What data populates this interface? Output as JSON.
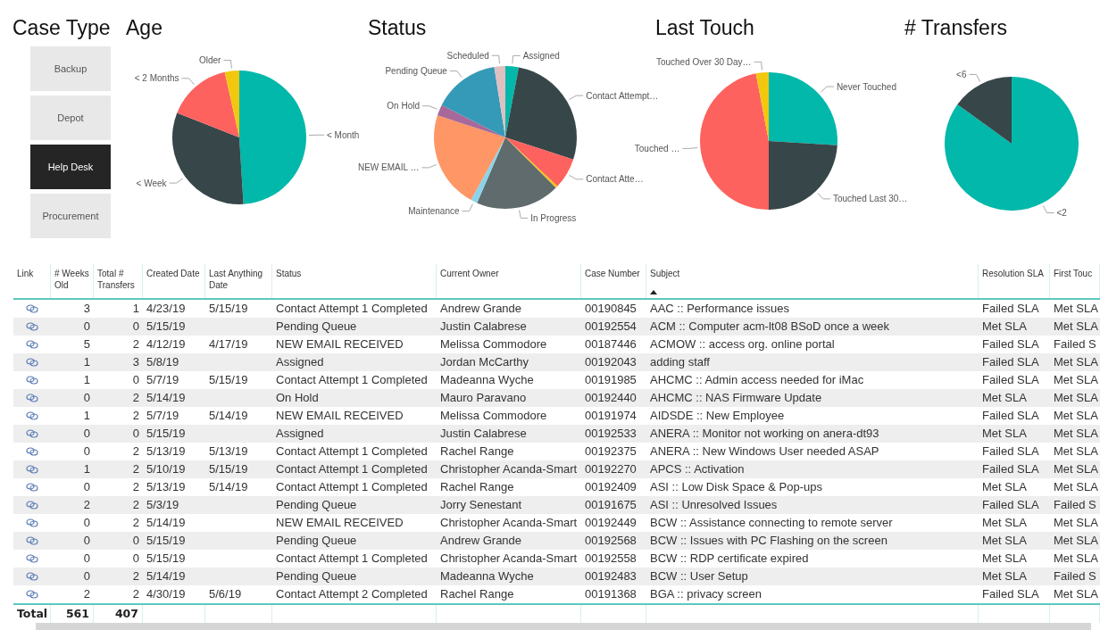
{
  "case_type": {
    "title": "Case Type",
    "buttons": [
      {
        "label": "Backup",
        "selected": false
      },
      {
        "label": "Depot",
        "selected": false
      },
      {
        "label": "Help Desk",
        "selected": true
      },
      {
        "label": "Procurement",
        "selected": false
      }
    ]
  },
  "charts": [
    {
      "title": "Age",
      "slices": [
        {
          "label": "< Month",
          "color": "#01b8aa"
        },
        {
          "label": "< Week",
          "color": "#374649"
        },
        {
          "label": "< 2 Months",
          "color": "#fd625e"
        },
        {
          "label": "Older",
          "color": "#f2c80f"
        }
      ]
    },
    {
      "title": "Status",
      "slices": [
        {
          "label": "Scheduled",
          "color": "#dfbfbf"
        },
        {
          "label": "Assigned",
          "color": "#01b8aa"
        },
        {
          "label": "Pending Queue",
          "color": "#3599b8"
        },
        {
          "label": "Contact Attempt…",
          "color": "#374649"
        },
        {
          "label": "On Hold",
          "color": "#a66999"
        },
        {
          "label": "Contact Atte…",
          "color": "#fd625e"
        },
        {
          "label": "NEW EMAIL …",
          "color": "#fe9666"
        },
        {
          "label": "Maintenance",
          "color": "#8ad4eb"
        },
        {
          "label": "In Progress",
          "color": "#5f6b6d"
        },
        {
          "color": "#f2c80f"
        }
      ]
    },
    {
      "title": "Last Touch",
      "slices": [
        {
          "label": "Never Touched",
          "color": "#01b8aa"
        },
        {
          "label": "Touched Last 30…",
          "color": "#374649"
        },
        {
          "label": "Touched …",
          "color": "#fd625e"
        },
        {
          "label": "Touched Over 30 Day…",
          "color": "#f2c80f"
        }
      ]
    },
    {
      "title": "# Transfers",
      "slices": [
        {
          "label": "<2",
          "color": "#01b8aa"
        },
        {
          "label": "<6",
          "color": "#374649"
        }
      ]
    }
  ],
  "table": {
    "columns": [
      {
        "label": "Link",
        "sorted": false
      },
      {
        "label": "# Weeks Old",
        "sorted": false
      },
      {
        "label": "Total # Transfers",
        "sorted": false
      },
      {
        "label": "Created Date",
        "sorted": false
      },
      {
        "label": "Last Anything Date",
        "sorted": false
      },
      {
        "label": "Status",
        "sorted": false
      },
      {
        "label": "Current Owner",
        "sorted": false
      },
      {
        "label": "Case Number",
        "sorted": false
      },
      {
        "label": "Subject",
        "sorted": true
      },
      {
        "label": "Resolution SLA",
        "sorted": false
      },
      {
        "label": "First Touc",
        "sorted": false
      }
    ],
    "rows": [
      {
        "weeks": "3",
        "transfers": "1",
        "created": "4/23/19",
        "last": "5/15/19",
        "status": "Contact Attempt 1 Completed",
        "owner": "Andrew Grande",
        "case": "00190845",
        "subject": "AAC :: Performance issues",
        "resolution": "Failed SLA",
        "first_touch": "Met SLA"
      },
      {
        "weeks": "0",
        "transfers": "0",
        "created": "5/15/19",
        "status": "Pending Queue",
        "owner": "Justin Calabrese",
        "case": "00192554",
        "subject": "ACM :: Computer acm-lt08 BSoD once a week",
        "resolution": "Met SLA",
        "first_touch": "Met SLA"
      },
      {
        "weeks": "5",
        "transfers": "2",
        "created": "4/12/19",
        "last": "4/17/19",
        "status": "NEW EMAIL RECEIVED",
        "owner": "Melissa Commodore",
        "case": "00187446",
        "subject": "ACMOW :: access org. online portal",
        "resolution": "Failed SLA",
        "first_touch": "Failed S"
      },
      {
        "weeks": "1",
        "transfers": "3",
        "created": "5/8/19",
        "status": "Assigned",
        "owner": "Jordan McCarthy",
        "case": "00192043",
        "subject": "adding staff",
        "resolution": "Failed SLA",
        "first_touch": "Met SLA"
      },
      {
        "weeks": "1",
        "transfers": "0",
        "created": "5/7/19",
        "last": "5/15/19",
        "status": "Contact Attempt 1 Completed",
        "owner": "Madeanna Wyche",
        "case": "00191985",
        "subject": "AHCMC :: Admin access needed for iMac",
        "resolution": "Failed SLA",
        "first_touch": "Met SLA"
      },
      {
        "weeks": "0",
        "transfers": "2",
        "created": "5/14/19",
        "status": "On Hold",
        "owner": "Mauro Paravano",
        "case": "00192440",
        "subject": "AHCMC :: NAS Firmware Update",
        "resolution": "Met SLA",
        "first_touch": "Met SLA"
      },
      {
        "weeks": "1",
        "transfers": "2",
        "created": "5/7/19",
        "last": "5/14/19",
        "status": "NEW EMAIL RECEIVED",
        "owner": "Melissa Commodore",
        "case": "00191974",
        "subject": "AIDSDE :: New Employee",
        "resolution": "Failed SLA",
        "first_touch": "Met SLA"
      },
      {
        "weeks": "0",
        "transfers": "0",
        "created": "5/15/19",
        "status": "Assigned",
        "owner": "Justin Calabrese",
        "case": "00192533",
        "subject": "ANERA :: Monitor not working on anera-dt93",
        "resolution": "Met SLA",
        "first_touch": "Met SLA"
      },
      {
        "weeks": "0",
        "transfers": "2",
        "created": "5/13/19",
        "last": "5/13/19",
        "status": "Contact Attempt 1 Completed",
        "owner": "Rachel Range",
        "case": "00192375",
        "subject": "ANERA :: New Windows User needed ASAP",
        "resolution": "Failed SLA",
        "first_touch": "Met SLA"
      },
      {
        "weeks": "1",
        "transfers": "2",
        "created": "5/10/19",
        "last": "5/15/19",
        "status": "Contact Attempt 1 Completed",
        "owner": "Christopher Acanda-Smart",
        "case": "00192270",
        "subject": "APCS :: Activation",
        "resolution": "Failed SLA",
        "first_touch": "Met SLA"
      },
      {
        "weeks": "0",
        "transfers": "2",
        "created": "5/13/19",
        "last": "5/14/19",
        "status": "Contact Attempt 1 Completed",
        "owner": "Rachel Range",
        "case": "00192409",
        "subject": "ASI :: Low Disk Space & Pop-ups",
        "resolution": "Met SLA",
        "first_touch": "Met SLA"
      },
      {
        "weeks": "2",
        "transfers": "2",
        "created": "5/3/19",
        "status": "Pending Queue",
        "owner": "Jorry Senestant",
        "case": "00191675",
        "subject": "ASI :: Unresolved Issues",
        "resolution": "Failed SLA",
        "first_touch": "Failed S"
      },
      {
        "weeks": "0",
        "transfers": "2",
        "created": "5/14/19",
        "status": "NEW EMAIL RECEIVED",
        "owner": "Christopher Acanda-Smart",
        "case": "00192449",
        "subject": "BCW :: Assistance connecting to remote server",
        "resolution": "Met SLA",
        "first_touch": "Met SLA"
      },
      {
        "weeks": "0",
        "transfers": "0",
        "created": "5/15/19",
        "status": "Pending Queue",
        "owner": "Andrew Grande",
        "case": "00192568",
        "subject": "BCW :: Issues with PC Flashing on the screen",
        "resolution": "Met SLA",
        "first_touch": "Met SLA"
      },
      {
        "weeks": "0",
        "transfers": "0",
        "created": "5/15/19",
        "status": "Contact Attempt 1 Completed",
        "owner": "Christopher Acanda-Smart",
        "case": "00192558",
        "subject": "BCW :: RDP certificate expired",
        "resolution": "Met SLA",
        "first_touch": "Met SLA"
      },
      {
        "weeks": "0",
        "transfers": "2",
        "created": "5/14/19",
        "status": "Pending Queue",
        "owner": "Madeanna Wyche",
        "case": "00192483",
        "subject": "BCW :: User Setup",
        "resolution": "Met SLA",
        "first_touch": "Failed S"
      },
      {
        "weeks": "2",
        "transfers": "2",
        "created": "4/30/19",
        "last": "5/6/19",
        "status": "Contact Attempt 2 Completed",
        "owner": "Rachel Range",
        "case": "00191368",
        "subject": "BGA :: privacy screen",
        "resolution": "Failed SLA",
        "first_touch": "Met SLA"
      }
    ],
    "total": {
      "label": "Total",
      "weeks": "561",
      "transfers": "407"
    }
  }
}
